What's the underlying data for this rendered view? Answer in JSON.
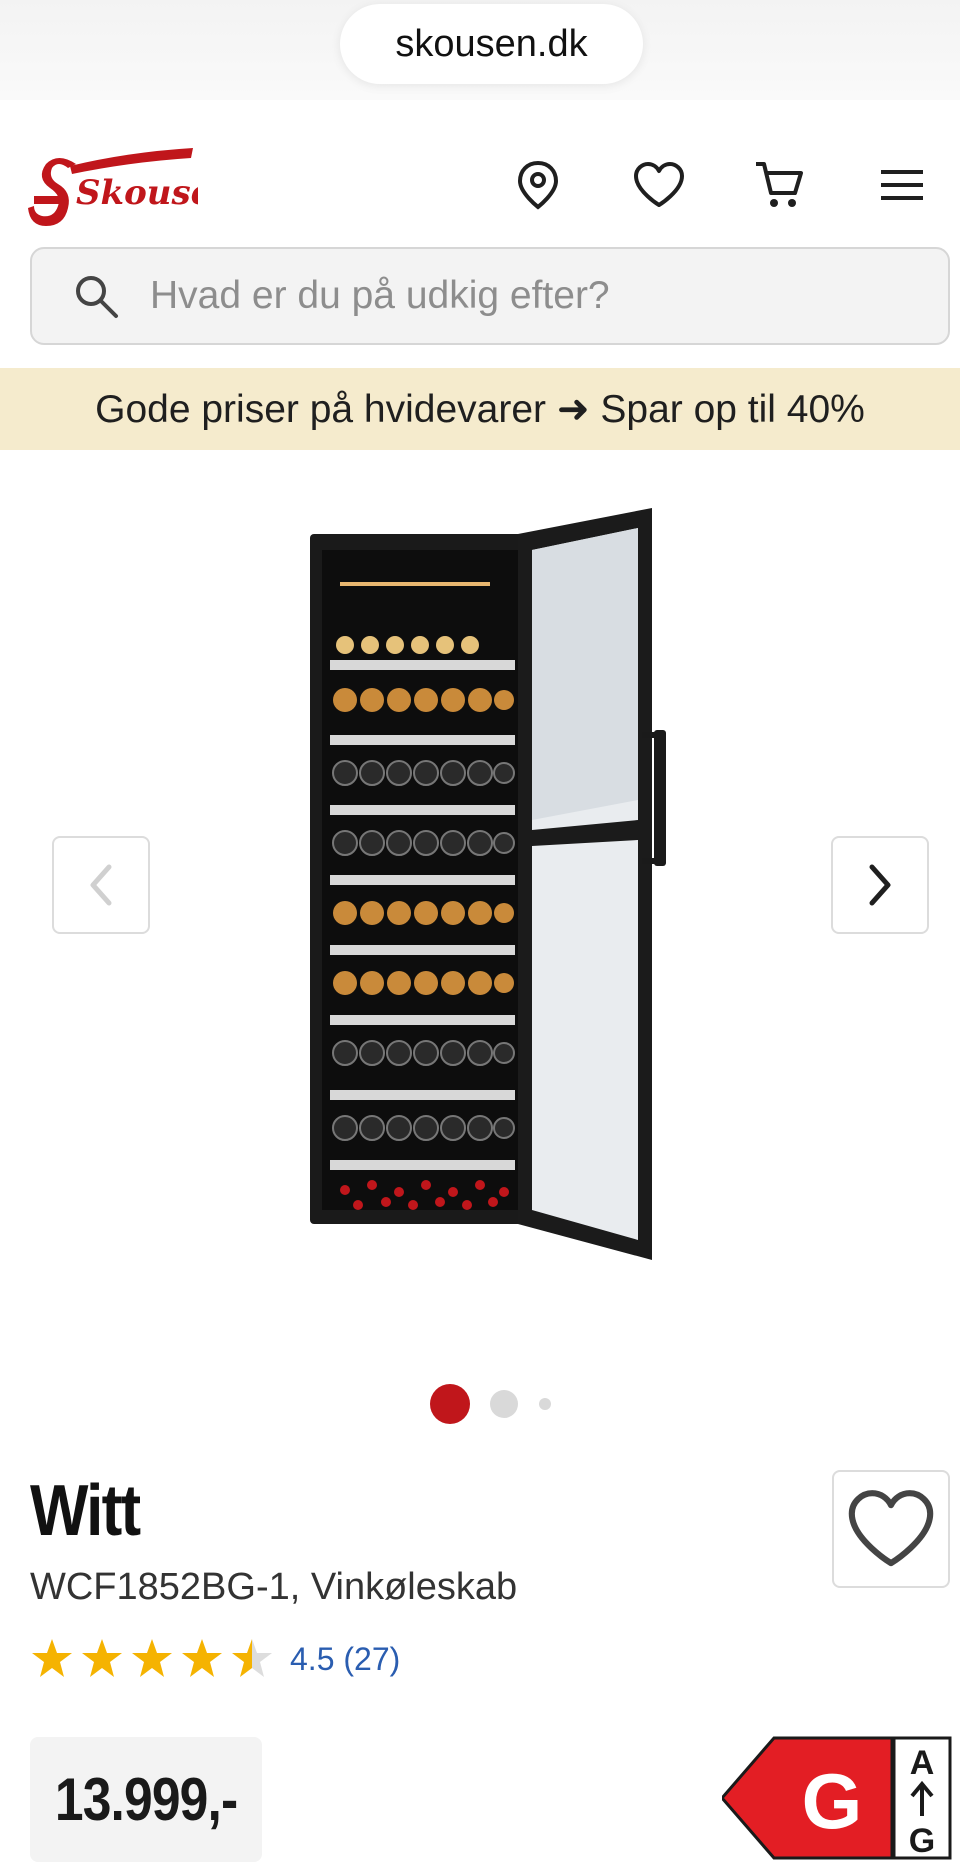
{
  "browser": {
    "url": "skousen.dk"
  },
  "header": {
    "logo_text": "Skousen",
    "icons": [
      "location-icon",
      "heart-icon",
      "cart-icon",
      "menu-icon"
    ]
  },
  "search": {
    "placeholder": "Hvad er du på udkig efter?",
    "value": ""
  },
  "promo": {
    "text": "Gode priser på hvidevarer ➜ Spar op til 40%"
  },
  "gallery": {
    "image_alt": "Witt WCF1852BG-1 vinkøleskab",
    "total_images": 3,
    "active_index": 0
  },
  "product": {
    "brand": "Witt",
    "model": "WCF1852BG-1, Vinkøleskab",
    "rating": 4.5,
    "rating_text": "4.5 (27)",
    "price": "13.999,-",
    "energy_class": "G",
    "energy_top": "A",
    "energy_bottom": "G"
  },
  "colors": {
    "brand_red": "#c0161b",
    "promo_bg": "#f5ebcd",
    "star": "#f5b301",
    "rating_link": "#2a5db0",
    "energy_red": "#e31e24"
  }
}
